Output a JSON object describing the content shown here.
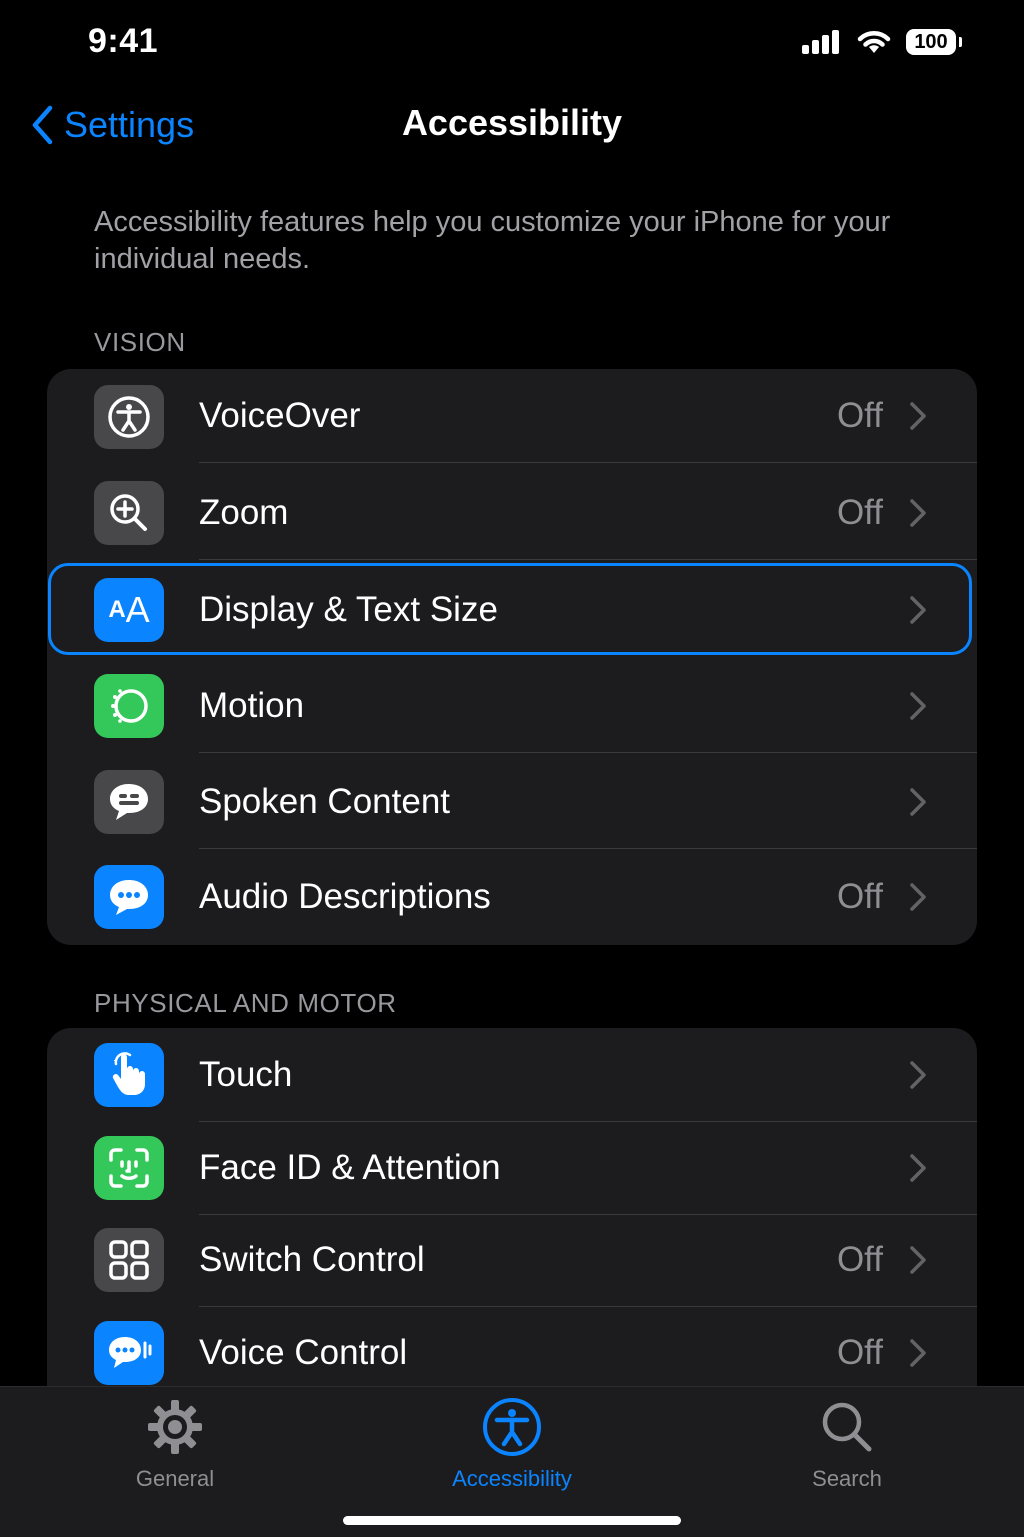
{
  "status_bar": {
    "time": "9:41",
    "battery": "100"
  },
  "nav": {
    "back_label": "Settings",
    "title": "Accessibility"
  },
  "description": "Accessibility features help you customize your iPhone for your individual needs.",
  "sections": {
    "vision": {
      "header": "VISION",
      "rows": [
        {
          "label": "VoiceOver",
          "value": "Off",
          "icon": "accessibility-icon",
          "icon_bg": "#48484a"
        },
        {
          "label": "Zoom",
          "value": "Off",
          "icon": "zoom-icon",
          "icon_bg": "#48484a"
        },
        {
          "label": "Display & Text Size",
          "value": "",
          "icon": "text-size-icon",
          "icon_bg": "#0a84ff",
          "icon_text": "AA"
        },
        {
          "label": "Motion",
          "value": "",
          "icon": "motion-icon",
          "icon_bg": "#34c759"
        },
        {
          "label": "Spoken Content",
          "value": "",
          "icon": "spoken-content-icon",
          "icon_bg": "#48484a"
        },
        {
          "label": "Audio Descriptions",
          "value": "Off",
          "icon": "audio-descriptions-icon",
          "icon_bg": "#0a84ff"
        }
      ]
    },
    "physical": {
      "header": "PHYSICAL AND MOTOR",
      "rows": [
        {
          "label": "Touch",
          "value": "",
          "icon": "touch-icon",
          "icon_bg": "#0a84ff"
        },
        {
          "label": "Face ID & Attention",
          "value": "",
          "icon": "face-id-icon",
          "icon_bg": "#34c759"
        },
        {
          "label": "Switch Control",
          "value": "Off",
          "icon": "switch-control-icon",
          "icon_bg": "#48484a"
        },
        {
          "label": "Voice Control",
          "value": "Off",
          "icon": "voice-control-icon",
          "icon_bg": "#0a84ff"
        }
      ]
    }
  },
  "tabs": [
    {
      "label": "General",
      "icon": "gear-icon",
      "active": false
    },
    {
      "label": "Accessibility",
      "icon": "accessibility-icon",
      "active": true
    },
    {
      "label": "Search",
      "icon": "search-icon",
      "active": false
    }
  ],
  "colors": {
    "accent": "#0a84ff",
    "background": "#000000",
    "group_background": "#1c1c1e",
    "secondary_text": "#8e8e93"
  }
}
